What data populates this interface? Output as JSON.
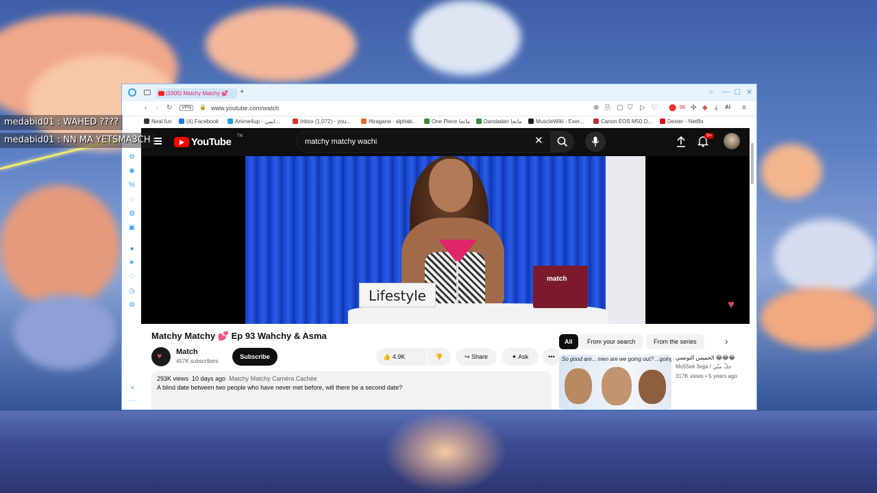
{
  "chat": [
    {
      "user": "medabid01",
      "message": ": WAHED ????"
    },
    {
      "user": "medabid01",
      "message": ": NN MA YETSMA3CH"
    }
  ],
  "browser": {
    "tab_title": "(3305) Matchy Matchy 💕",
    "new_tab_icon": "plus-icon",
    "vpn_label": "VPN",
    "url": "www.youtube.com/watch",
    "ai_label": "AI",
    "bookmarks": [
      {
        "label": "Neal.fun",
        "color": "#333333"
      },
      {
        "label": "(4) Facebook",
        "color": "#1877f2"
      },
      {
        "label": "Anime4up - انمي...",
        "color": "#22a0d8"
      },
      {
        "label": "Inbox (1,072) - you...",
        "color": "#d93025"
      },
      {
        "label": "Hiragana - alphab...",
        "color": "#e86a2c"
      },
      {
        "label": "One Piece مانجا",
        "color": "#3c8a3c"
      },
      {
        "label": "Dandadan مانجا",
        "color": "#3c8a3c"
      },
      {
        "label": "MuscleWiki - Exer...",
        "color": "#222222"
      },
      {
        "label": "Canon EOS M50 D...",
        "color": "#c4302b"
      },
      {
        "label": "Dexter - Netflix",
        "color": "#e50914"
      }
    ]
  },
  "youtube": {
    "logo_text": "YouTube",
    "logo_tm": "TN",
    "search_value": "matchy matchy wachi",
    "notification_count": "9+",
    "video": {
      "sign_text": "Lifestyle",
      "box_label": "match"
    },
    "title": "Matchy Matchy 💕 Ep 93 Wahchy & Asma",
    "channel": {
      "name": "Match",
      "subscribers": "457K subscribers"
    },
    "subscribe_label": "Subscribe",
    "actions": {
      "likes": "4.9K",
      "share": "Share",
      "ask": "Ask",
      "more": "•••"
    },
    "description": {
      "views": "293K views",
      "date": "10 days ago",
      "tag": "Matchy Matchy Caméra Cachée",
      "text": "A blind date between two people who have never met before, will there be a second date?"
    },
    "chips": [
      "All",
      "From your search",
      "From the series"
    ],
    "recommendation": {
      "title": "الخميس التونسي 😂😂😂",
      "channel": "Mo55ek 3ejja / حكّ متّي",
      "meta": "317K views • 5 years ago",
      "thumb_text": "So good are... men are we going out? ...going to be Saturday"
    }
  }
}
